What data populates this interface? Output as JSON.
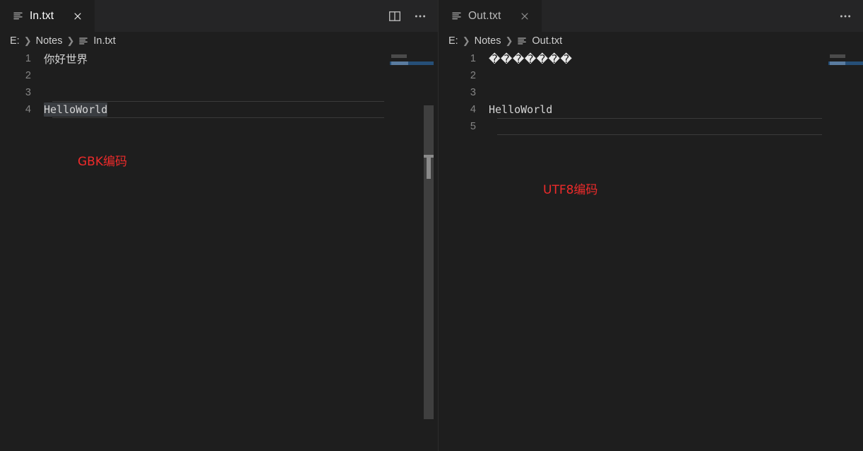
{
  "window": {
    "background": "#1e1e1e",
    "tab_inactive_background": "#252526",
    "accent_red": "#ee2b2b",
    "selection_color": "#3a3d41",
    "minimap_selection_color": "#264f78"
  },
  "panels": [
    {
      "id": "left",
      "tab": {
        "label": "In.txt",
        "icon": "text-file-icon",
        "close_icon": "close-icon",
        "active": true
      },
      "tabbar_actions": [
        {
          "name": "split-editor-icon",
          "label": "Split Editor"
        },
        {
          "name": "more-actions-icon",
          "label": "More Actions..."
        }
      ],
      "breadcrumbs": [
        {
          "label": "E:",
          "icon": null
        },
        {
          "label": "Notes",
          "icon": null
        },
        {
          "label": "In.txt",
          "icon": "text-file-icon"
        }
      ],
      "editor": {
        "lines": [
          {
            "number": "1",
            "text": "你好世界",
            "kind": "cjk",
            "selected": false,
            "current": false
          },
          {
            "number": "2",
            "text": "",
            "kind": "plain",
            "selected": false,
            "current": false
          },
          {
            "number": "3",
            "text": "",
            "kind": "plain",
            "selected": false,
            "current": false
          },
          {
            "number": "4",
            "text": "HelloWorld",
            "kind": "mono",
            "selected": true,
            "current": true
          }
        ]
      },
      "annotation": {
        "text": "GBK编码",
        "color": "#ee2b2b"
      }
    },
    {
      "id": "right",
      "tab": {
        "label": "Out.txt",
        "icon": "text-file-icon",
        "close_icon": "close-icon",
        "active": true
      },
      "tabbar_actions": [
        {
          "name": "more-actions-icon",
          "label": "More Actions..."
        }
      ],
      "breadcrumbs": [
        {
          "label": "E:",
          "icon": null
        },
        {
          "label": "Notes",
          "icon": null
        },
        {
          "label": "Out.txt",
          "icon": "text-file-icon"
        }
      ],
      "editor": {
        "lines": [
          {
            "number": "1",
            "text": "�������",
            "kind": "replacement",
            "selected": false,
            "current": false
          },
          {
            "number": "2",
            "text": "",
            "kind": "plain",
            "selected": false,
            "current": false
          },
          {
            "number": "3",
            "text": "",
            "kind": "plain",
            "selected": false,
            "current": false
          },
          {
            "number": "4",
            "text": "HelloWorld",
            "kind": "mono",
            "selected": false,
            "current": false
          },
          {
            "number": "5",
            "text": "",
            "kind": "plain",
            "selected": false,
            "current": true
          }
        ]
      },
      "annotation": {
        "text": "UTF8编码",
        "color": "#ee2b2b"
      }
    }
  ]
}
